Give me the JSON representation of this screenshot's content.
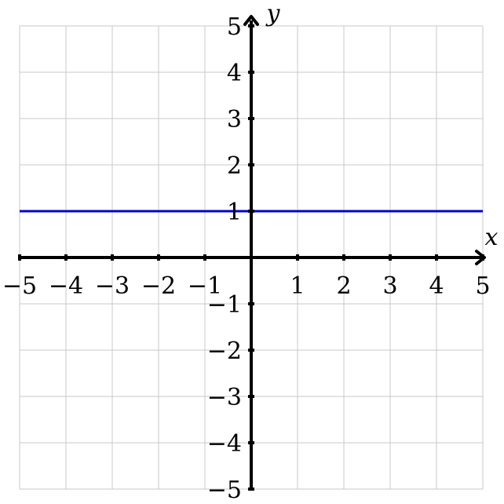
{
  "chart_data": {
    "type": "line",
    "xlabel": "x",
    "ylabel": "y",
    "xlim": [
      -5,
      5
    ],
    "ylim": [
      -5,
      5
    ],
    "grid": true,
    "x_ticks": [
      -5,
      -4,
      -3,
      -2,
      -1,
      1,
      2,
      3,
      4,
      5
    ],
    "y_ticks": [
      -5,
      -4,
      -3,
      -2,
      -1,
      1,
      2,
      3,
      4,
      5
    ],
    "x_tick_labels": [
      "−5",
      "−4",
      "−3",
      "−2",
      "−1",
      "1",
      "2",
      "3",
      "4",
      "5"
    ],
    "y_tick_labels": [
      "−5",
      "−4",
      "−3",
      "−2",
      "−1",
      "1",
      "2",
      "3",
      "4",
      "5"
    ],
    "series": [
      {
        "x": [
          -5,
          5
        ],
        "y": [
          1,
          1
        ],
        "color": "#0000cc"
      }
    ],
    "colors": {
      "axis": "#000000",
      "grid": "#c8c8c8",
      "line": "#0000cc"
    }
  }
}
